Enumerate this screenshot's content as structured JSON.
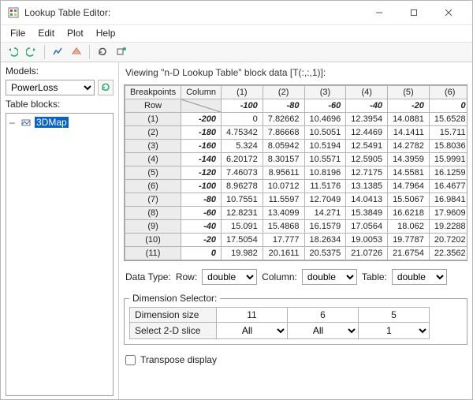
{
  "window": {
    "title": "Lookup Table Editor:"
  },
  "menu": {
    "file": "File",
    "edit": "Edit",
    "plot": "Plot",
    "help": "Help"
  },
  "left": {
    "models_label": "Models:",
    "model_value": "PowerLoss",
    "table_blocks_label": "Table blocks:",
    "tree_item": "3DMap"
  },
  "right": {
    "viewing": "Viewing \"n-D Lookup Table\" block data [T(:,:,1)]:",
    "corner_bp": "Breakpoints",
    "corner_col": "Column",
    "corner_row": "Row",
    "col_labels": [
      "(1)",
      "(2)",
      "(3)",
      "(4)",
      "(5)",
      "(6)"
    ],
    "col_bp": [
      "-100",
      "-80",
      "-60",
      "-40",
      "-20",
      "0"
    ],
    "row_labels": [
      "(1)",
      "(2)",
      "(3)",
      "(4)",
      "(5)",
      "(6)",
      "(7)",
      "(8)",
      "(9)",
      "(10)",
      "(11)"
    ],
    "row_bp": [
      "-200",
      "-180",
      "-160",
      "-140",
      "-120",
      "-100",
      "-80",
      "-60",
      "-40",
      "-20",
      "0"
    ],
    "cells": [
      [
        "0",
        "7.82662",
        "10.4696",
        "12.3954",
        "14.0881",
        "15.6528"
      ],
      [
        "4.75342",
        "7.86668",
        "10.5051",
        "12.4469",
        "14.1411",
        "15.711"
      ],
      [
        "5.324",
        "8.05942",
        "10.5194",
        "12.5491",
        "14.2782",
        "15.8036"
      ],
      [
        "6.20172",
        "8.30157",
        "10.5571",
        "12.5905",
        "14.3959",
        "15.9991"
      ],
      [
        "7.46073",
        "8.95611",
        "10.8196",
        "12.7175",
        "14.5581",
        "16.1259"
      ],
      [
        "8.96278",
        "10.0712",
        "11.5176",
        "13.1385",
        "14.7964",
        "16.4677"
      ],
      [
        "10.7551",
        "11.5597",
        "12.7049",
        "14.0413",
        "15.5067",
        "16.9841"
      ],
      [
        "12.8231",
        "13.4099",
        "14.271",
        "15.3849",
        "16.6218",
        "17.9609"
      ],
      [
        "15.091",
        "15.4868",
        "16.1579",
        "17.0564",
        "18.062",
        "19.2288"
      ],
      [
        "17.5054",
        "17.777",
        "18.2634",
        "19.0053",
        "19.7787",
        "20.7202"
      ],
      [
        "19.982",
        "20.1611",
        "20.5375",
        "21.0726",
        "21.6754",
        "22.3562"
      ]
    ],
    "dtype_label": "Data Type:",
    "dtype_row_label": "Row:",
    "dtype_col_label": "Column:",
    "dtype_tbl_label": "Table:",
    "dtype_row": "double",
    "dtype_col": "double",
    "dtype_tbl": "double",
    "dim_legend": "Dimension Selector:",
    "dim_size_label": "Dimension size",
    "dim_select_label": "Select 2-D slice",
    "dim_sizes": [
      "11",
      "6",
      "5"
    ],
    "dim_slices": [
      "All",
      "All",
      "1"
    ],
    "transpose_label": "Transpose display"
  },
  "chart_data": {
    "type": "table",
    "row_breakpoints": [
      -200,
      -180,
      -160,
      -140,
      -120,
      -100,
      -80,
      -60,
      -40,
      -20,
      0
    ],
    "col_breakpoints": [
      -100,
      -80,
      -60,
      -40,
      -20,
      0
    ],
    "values": [
      [
        0,
        7.82662,
        10.4696,
        12.3954,
        14.0881,
        15.6528
      ],
      [
        4.75342,
        7.86668,
        10.5051,
        12.4469,
        14.1411,
        15.711
      ],
      [
        5.324,
        8.05942,
        10.5194,
        12.5491,
        14.2782,
        15.8036
      ],
      [
        6.20172,
        8.30157,
        10.5571,
        12.5905,
        14.3959,
        15.9991
      ],
      [
        7.46073,
        8.95611,
        10.8196,
        12.7175,
        14.5581,
        16.1259
      ],
      [
        8.96278,
        10.0712,
        11.5176,
        13.1385,
        14.7964,
        16.4677
      ],
      [
        10.7551,
        11.5597,
        12.7049,
        14.0413,
        15.5067,
        16.9841
      ],
      [
        12.8231,
        13.4099,
        14.271,
        15.3849,
        16.6218,
        17.9609
      ],
      [
        15.091,
        15.4868,
        16.1579,
        17.0564,
        18.062,
        19.2288
      ],
      [
        17.5054,
        17.777,
        18.2634,
        19.0053,
        19.7787,
        20.7202
      ],
      [
        19.982,
        20.1611,
        20.5375,
        21.0726,
        21.6754,
        22.3562
      ]
    ]
  }
}
